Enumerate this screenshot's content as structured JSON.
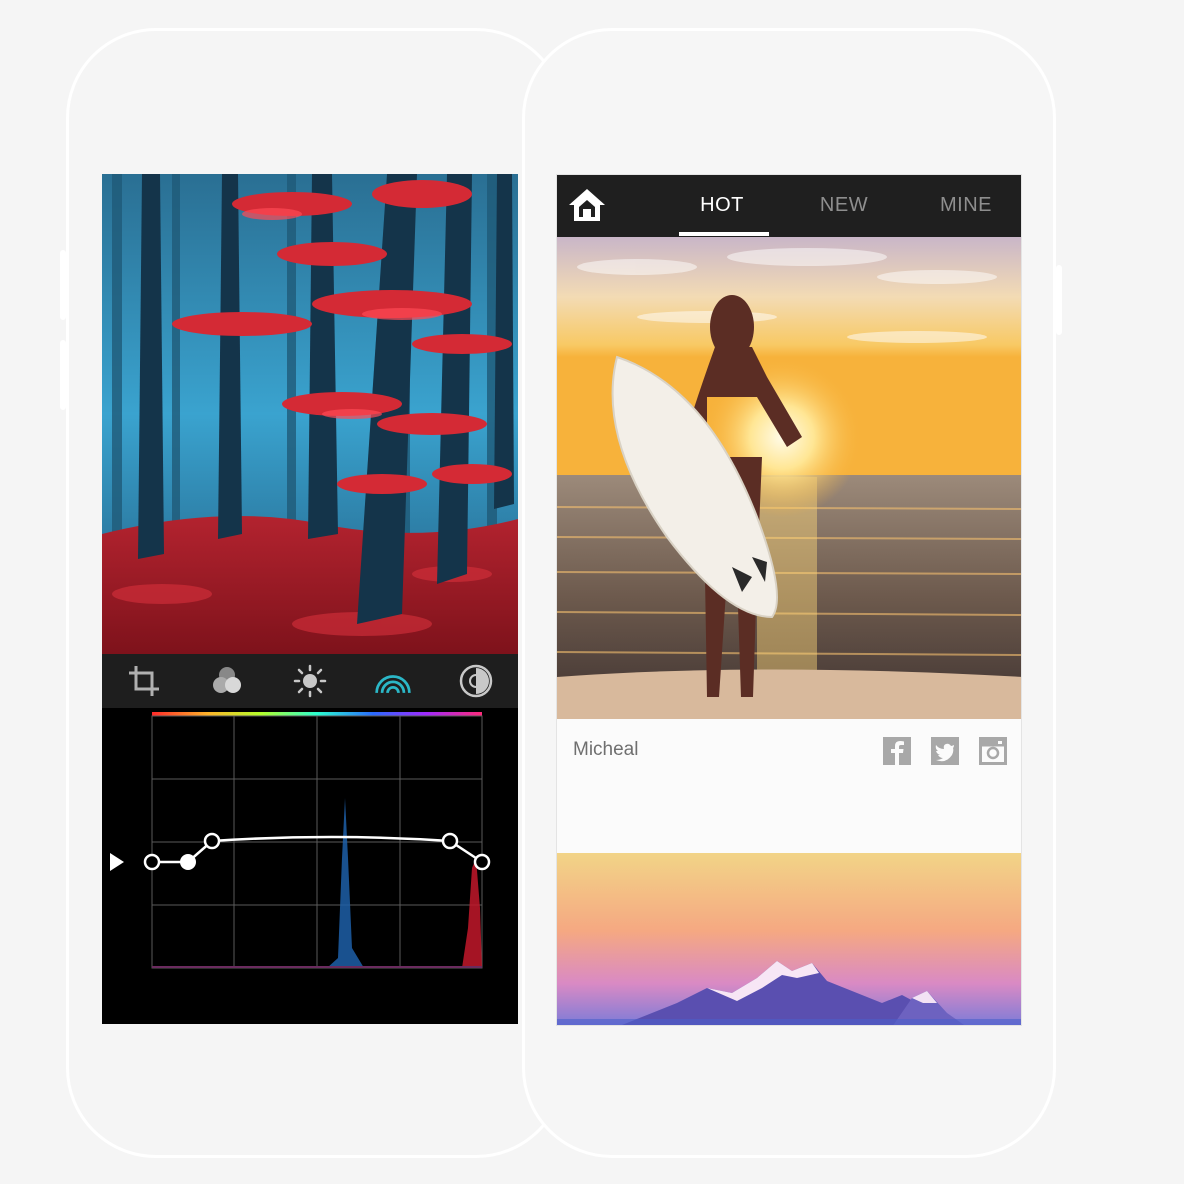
{
  "nav": {
    "tabs": [
      {
        "label": "HOT",
        "active": true
      },
      {
        "label": "NEW",
        "active": false
      },
      {
        "label": "MINE",
        "active": false
      }
    ]
  },
  "post": {
    "author": "Micheal",
    "share_icons": [
      "facebook-icon",
      "twitter-icon",
      "instagram-icon"
    ]
  },
  "editor": {
    "tools": [
      "crop-icon",
      "color-mix-icon",
      "brightness-icon",
      "curves-icon",
      "vignette-icon"
    ],
    "active_tool": "curves-icon"
  },
  "colors": {
    "nav_bg": "#1f1f1f",
    "active_tool": "#2bb7c7",
    "icon_gray": "#9a9a9a"
  }
}
